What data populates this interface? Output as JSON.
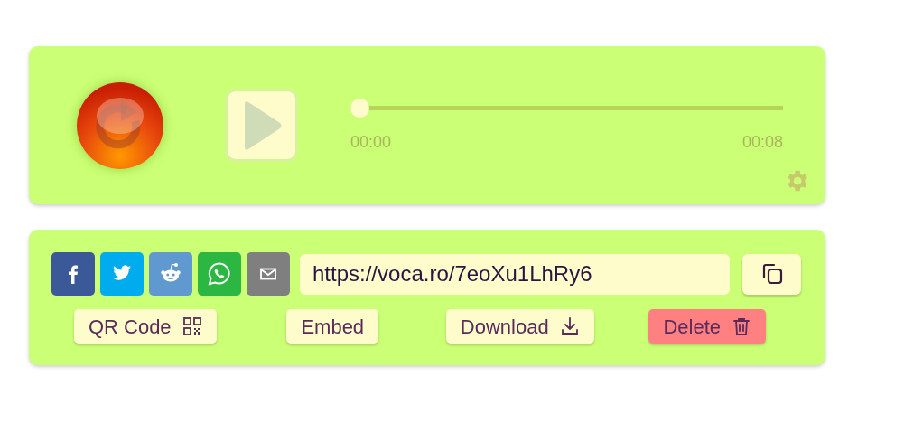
{
  "player": {
    "level": 0,
    "current_time": "00:00",
    "duration": "00:08"
  },
  "share": {
    "networks": [
      {
        "kind": "facebook"
      },
      {
        "kind": "twitter"
      },
      {
        "kind": "reddit"
      },
      {
        "kind": "whatsapp"
      },
      {
        "kind": "email"
      }
    ],
    "url": {
      "value": "https://voca.ro/7eoXu1LhRy6"
    }
  },
  "actions": [
    {
      "label": "QR Code",
      "kind": "qr"
    },
    {
      "label": "Embed",
      "kind": "embed"
    },
    {
      "label": "Download",
      "kind": "download"
    },
    {
      "label": "Delete",
      "kind": "delete"
    }
  ]
}
